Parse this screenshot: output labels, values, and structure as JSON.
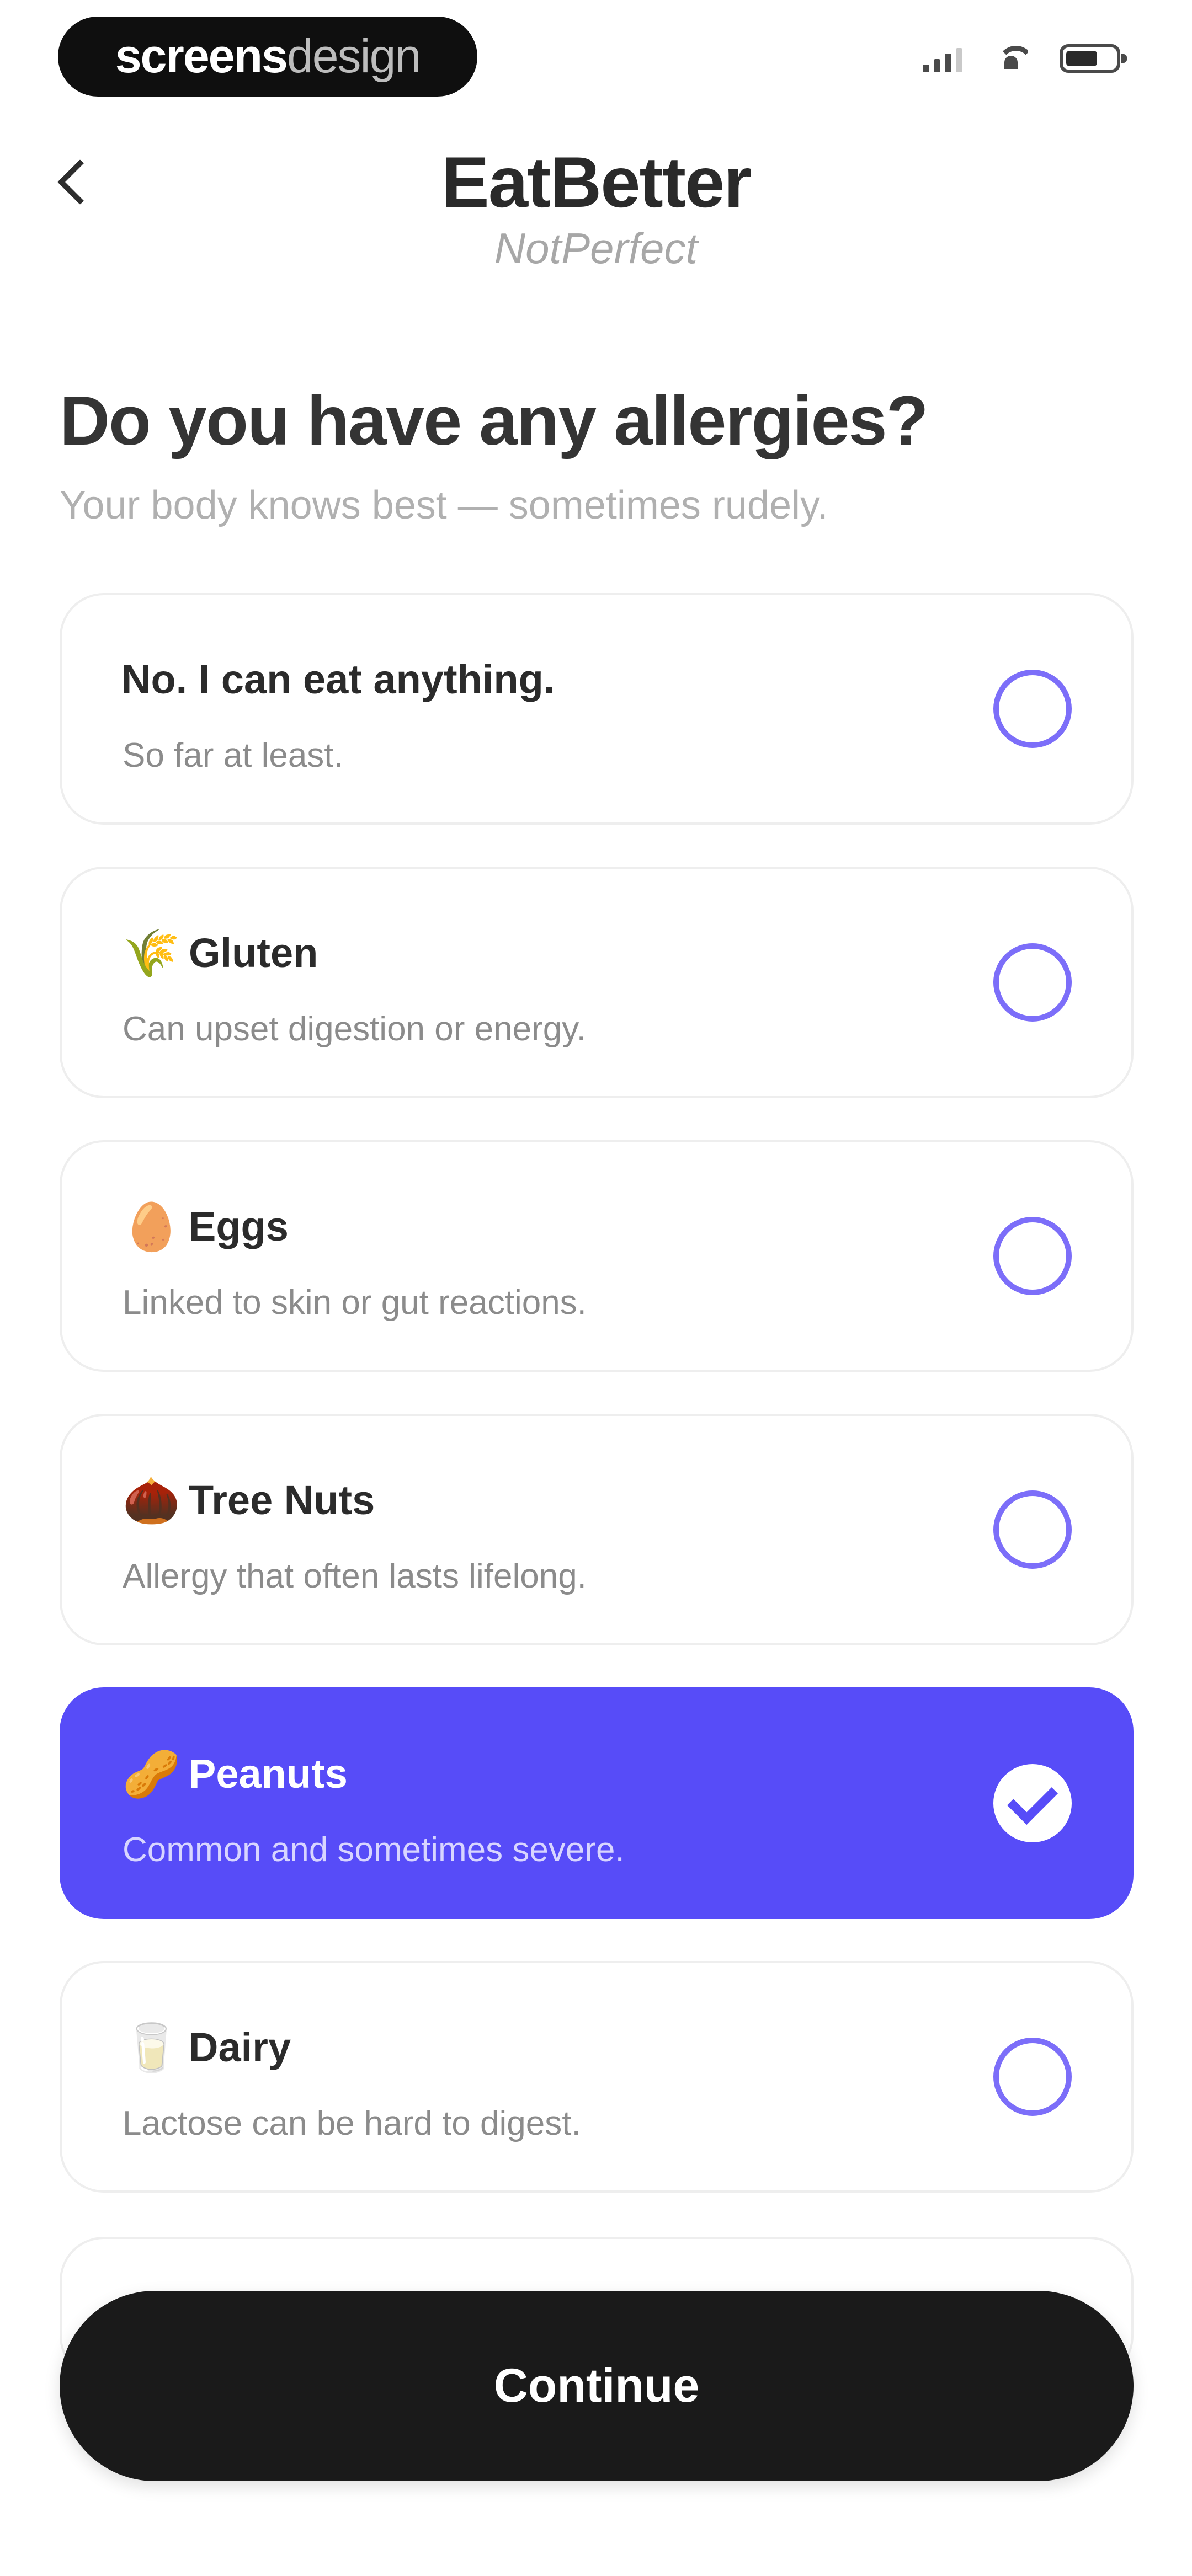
{
  "status_bar": {
    "brand_left": "screens",
    "brand_right": "design",
    "signal_icon": "signal-icon",
    "wifi_icon": "wifi-icon",
    "battery_icon": "battery-icon"
  },
  "header": {
    "title": "EatBetter",
    "subtitle": "NotPerfect",
    "back_icon": "chevron-left-icon"
  },
  "question": {
    "title": "Do you have any allergies?",
    "subtitle": "Your body knows best — sometimes rudely."
  },
  "options": [
    {
      "title": "No. I can eat anything.",
      "description": "So far at least.",
      "emoji": "",
      "selected": false
    },
    {
      "title": "Gluten",
      "description": "Can upset digestion or energy.",
      "emoji": "🌾",
      "selected": false
    },
    {
      "title": "Eggs",
      "description": "Linked to skin or gut reactions.",
      "emoji": "🥚",
      "selected": false
    },
    {
      "title": "Tree Nuts",
      "description": "Allergy that often lasts lifelong.",
      "emoji": "🌰",
      "selected": false
    },
    {
      "title": "Peanuts",
      "description": "Common and sometimes severe.",
      "emoji": "🥜",
      "selected": true
    },
    {
      "title": "Dairy",
      "description": "Lactose can be hard to digest.",
      "emoji": "🥛",
      "selected": false
    }
  ],
  "footer": {
    "continue_label": "Continue"
  },
  "colors": {
    "accent": "#574cf8",
    "radio_outline": "#7c6ef9",
    "button_dark": "#1a1a1a"
  }
}
